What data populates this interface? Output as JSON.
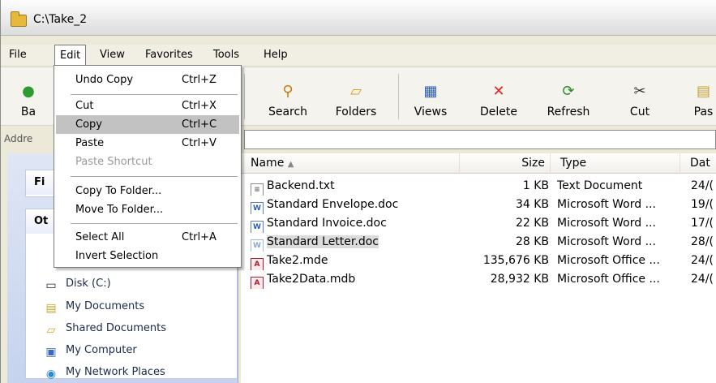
{
  "window": {
    "title": "C:\\Take_2"
  },
  "menubar": {
    "items": [
      "File",
      "Edit",
      "View",
      "Favorites",
      "Tools",
      "Help"
    ]
  },
  "toolbar": {
    "back_label_partial": "Ba",
    "search": "Search",
    "folders": "Folders",
    "views": "Views",
    "delete": "Delete",
    "refresh": "Refresh",
    "cut": "Cut",
    "paste_partial": "Pas"
  },
  "address": {
    "label_partial": "Addre"
  },
  "edit_menu": {
    "items": [
      {
        "label": "Undo Copy",
        "shortcut": "Ctrl+Z"
      },
      {
        "label": "Cut",
        "shortcut": "Ctrl+X"
      },
      {
        "label": "Copy",
        "shortcut": "Ctrl+C"
      },
      {
        "label": "Paste",
        "shortcut": "Ctrl+V"
      },
      {
        "label": "Paste Shortcut",
        "shortcut": ""
      },
      {
        "label": "Copy To Folder...",
        "shortcut": ""
      },
      {
        "label": "Move To Folder...",
        "shortcut": ""
      },
      {
        "label": "Select All",
        "shortcut": "Ctrl+A"
      },
      {
        "label": "Invert Selection",
        "shortcut": ""
      }
    ]
  },
  "left_pane": {
    "section1_partial": "Fi",
    "section2_partial": "Ot",
    "disk_partial": "Disk (C:)",
    "places": [
      "My Documents",
      "Shared Documents",
      "My Computer",
      "My Network Places"
    ]
  },
  "file_list": {
    "columns": {
      "name": "Name",
      "size": "Size",
      "type": "Type",
      "date": "Dat"
    },
    "rows": [
      {
        "name": "Backend.txt",
        "size": "1 KB",
        "type": "Text Document",
        "date": "24/("
      },
      {
        "name": "Standard Envelope.doc",
        "size": "34 KB",
        "type": "Microsoft Word ...",
        "date": "19/("
      },
      {
        "name": "Standard Invoice.doc",
        "size": "22 KB",
        "type": "Microsoft Word ...",
        "date": "17/("
      },
      {
        "name": "Standard Letter.doc",
        "size": "28 KB",
        "type": "Microsoft Word ...",
        "date": "28/("
      },
      {
        "name": "Take2.mde",
        "size": "135,676 KB",
        "type": "Microsoft Office ...",
        "date": "24/("
      },
      {
        "name": "Take2Data.mdb",
        "size": "28,932 KB",
        "type": "Microsoft Office ...",
        "date": "24/("
      }
    ]
  }
}
